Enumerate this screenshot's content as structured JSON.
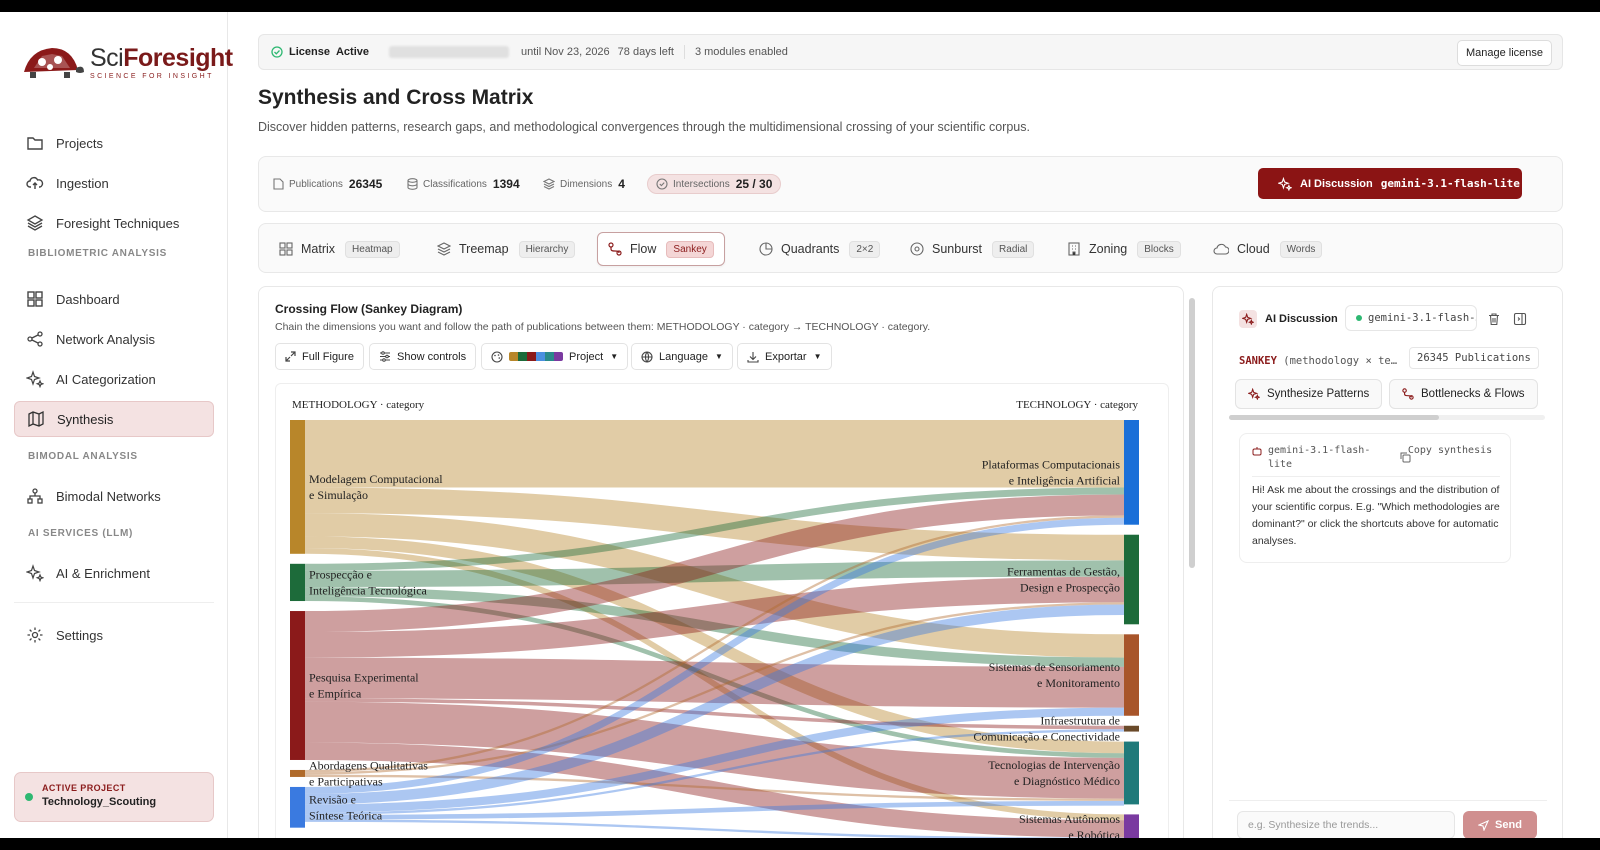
{
  "app": {
    "logo_main": "Sci",
    "logo_accent": "Foresight",
    "logo_tagline": "SCIENCE FOR INSIGHT"
  },
  "sidebar": {
    "items": [
      {
        "label": "Projects",
        "icon": "folder-icon"
      },
      {
        "label": "Ingestion",
        "icon": "upload-cloud-icon"
      },
      {
        "label": "Foresight Techniques",
        "icon": "layers-icon"
      },
      {
        "label": "Dashboard",
        "icon": "grid-icon"
      },
      {
        "label": "Network Analysis",
        "icon": "share-nodes-icon"
      },
      {
        "label": "AI Categorization",
        "icon": "sparkles-icon"
      },
      {
        "label": "Synthesis",
        "icon": "map-icon",
        "active": true
      },
      {
        "label": "Bimodal Networks",
        "icon": "network-icon"
      },
      {
        "label": "AI & Enrichment",
        "icon": "sparkles-icon"
      },
      {
        "label": "Settings",
        "icon": "gear-icon"
      }
    ],
    "sections": [
      "BIBLIOMETRIC ANALYSIS",
      "BIMODAL ANALYSIS",
      "AI SERVICES (LLM)"
    ],
    "active_project": {
      "label": "ACTIVE PROJECT",
      "name": "Technology_Scouting"
    }
  },
  "license": {
    "label": "License",
    "status": "Active",
    "until": "until Nov 23, 2026",
    "days_left": "78 days left",
    "modules": "3 modules enabled",
    "manage": "Manage license"
  },
  "page": {
    "title": "Synthesis and Cross Matrix",
    "subtitle": "Discover hidden patterns, research gaps, and methodological convergences through the multidimensional crossing of your scientific corpus."
  },
  "stats": {
    "publications": {
      "label": "Publications",
      "value": "26345"
    },
    "classifications": {
      "label": "Classifications",
      "value": "1394"
    },
    "dimensions": {
      "label": "Dimensions",
      "value": "4"
    },
    "intersections": {
      "label": "Intersections",
      "value": "25 / 30"
    },
    "ai_button": {
      "label": "AI Discussion",
      "model": "gemini-3.1-flash-lite"
    }
  },
  "tabs": [
    {
      "label": "Matrix",
      "badge": "Heatmap"
    },
    {
      "label": "Treemap",
      "badge": "Hierarchy"
    },
    {
      "label": "Flow",
      "badge": "Sankey",
      "active": true
    },
    {
      "label": "Quadrants",
      "badge": "2×2"
    },
    {
      "label": "Sunburst",
      "badge": "Radial"
    },
    {
      "label": "Zoning",
      "badge": "Blocks"
    },
    {
      "label": "Cloud",
      "badge": "Words"
    }
  ],
  "flow": {
    "title": "Crossing Flow (Sankey Diagram)",
    "subtitle": "Chain the dimensions you want and follow the path of publications between them: METHODOLOGY · category → TECHNOLOGY · category.",
    "buttons": {
      "full": "Full Figure",
      "controls": "Show controls",
      "palette": "Project",
      "language": "Language",
      "export": "Exportar"
    },
    "palette_colors": [
      "#b8862a",
      "#1d6b3a",
      "#8b1a1a",
      "#4a8fe0",
      "#2a8a8a",
      "#7a3aa0"
    ]
  },
  "chart_data": {
    "type": "sankey",
    "left_header": "METHODOLOGY · category",
    "right_header": "TECHNOLOGY · category",
    "left_nodes": [
      {
        "lines": [
          "Modelagem Computacional",
          "e Simulação"
        ],
        "color": "#b8862a",
        "value": 115
      },
      {
        "lines": [
          "Prospecção e",
          "Inteligência Tecnológica"
        ],
        "color": "#1d6b3a",
        "value": 32
      },
      {
        "lines": [
          "Pesquisa Experimental",
          "e Empírica"
        ],
        "color": "#8b1a1a",
        "value": 128
      },
      {
        "lines": [
          "Abordagens Qualitativas",
          "e Participativas"
        ],
        "color": "#b06a2a",
        "value": 6
      },
      {
        "lines": [
          "Revisão e",
          "Síntese Teórica"
        ],
        "color": "#3a7ae0",
        "value": 35
      }
    ],
    "right_nodes": [
      {
        "lines": [
          "Plataformas Computacionais",
          "e Inteligência Artificial"
        ],
        "color": "#1a6fd8",
        "value": 90
      },
      {
        "lines": [
          "Ferramentas de Gestão,",
          "Design e Prospecção"
        ],
        "color": "#1d6b3a",
        "value": 77
      },
      {
        "lines": [
          "Sistemas de Sensoriamento",
          "e Monitoramento"
        ],
        "color": "#a8552a",
        "value": 70
      },
      {
        "lines": [
          "Infraestrutura de",
          "Comunicação e Conectividade"
        ],
        "color": "#6a4a2a",
        "value": 5
      },
      {
        "lines": [
          "Tecnologias de Intervenção",
          "e Diagnóstico Médico"
        ],
        "color": "#1f7a7a",
        "value": 54
      },
      {
        "lines": [
          "Sistemas Autônomos",
          "e Robótica"
        ],
        "color": "#7a3aa0",
        "value": 22
      }
    ],
    "links": [
      {
        "source": 0,
        "target": 0,
        "value": 58
      },
      {
        "source": 0,
        "target": 1,
        "value": 22
      },
      {
        "source": 0,
        "target": 2,
        "value": 20
      },
      {
        "source": 0,
        "target": 4,
        "value": 10
      },
      {
        "source": 0,
        "target": 5,
        "value": 5
      },
      {
        "source": 1,
        "target": 0,
        "value": 6
      },
      {
        "source": 1,
        "target": 1,
        "value": 14
      },
      {
        "source": 1,
        "target": 2,
        "value": 8
      },
      {
        "source": 1,
        "target": 4,
        "value": 4
      },
      {
        "source": 2,
        "target": 0,
        "value": 18
      },
      {
        "source": 2,
        "target": 1,
        "value": 22
      },
      {
        "source": 2,
        "target": 2,
        "value": 35
      },
      {
        "source": 2,
        "target": 3,
        "value": 3
      },
      {
        "source": 2,
        "target": 4,
        "value": 35
      },
      {
        "source": 2,
        "target": 5,
        "value": 15
      },
      {
        "source": 3,
        "target": 0,
        "value": 2
      },
      {
        "source": 3,
        "target": 1,
        "value": 2
      },
      {
        "source": 3,
        "target": 4,
        "value": 2
      },
      {
        "source": 4,
        "target": 0,
        "value": 6
      },
      {
        "source": 4,
        "target": 1,
        "value": 9
      },
      {
        "source": 4,
        "target": 2,
        "value": 7
      },
      {
        "source": 4,
        "target": 3,
        "value": 2
      },
      {
        "source": 4,
        "target": 4,
        "value": 4
      },
      {
        "source": 4,
        "target": 5,
        "value": 2
      }
    ]
  },
  "chat": {
    "title": "AI Discussion",
    "model": "gemini-3.1-flash-…",
    "sankey_tag_prefix": "SANKEY",
    "sankey_tag_rest": "(methodology × te…",
    "publications": "26345 Publications",
    "chips": [
      "Synthesize Patterns",
      "Bottlenecks & Flows"
    ],
    "message": {
      "model": "gemini-3.1-flash-lite",
      "copy": "Copy synthesis",
      "text": "Hi! Ask me about the crossings and the distribution of your scientific corpus. E.g. \"Which methodologies are dominant?\" or click the shortcuts above for automatic analyses."
    },
    "input_placeholder": "e.g. Synthesize the trends...",
    "send": "Send"
  }
}
